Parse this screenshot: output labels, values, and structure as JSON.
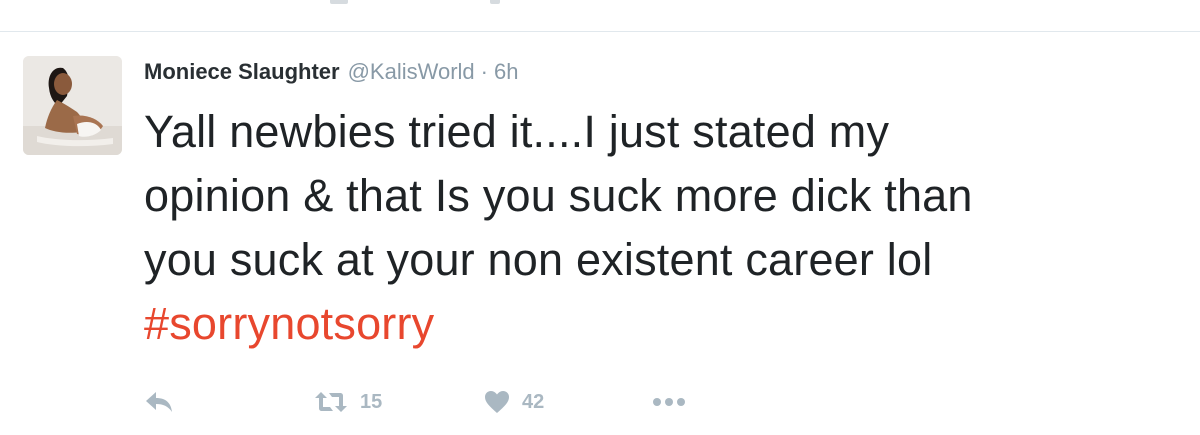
{
  "tweet": {
    "author": {
      "fullname": "Moniece Slaughter",
      "username": "@KalisWorld",
      "separator": "·",
      "timestamp": "6h"
    },
    "text_lines": [
      "Yall newbies tried it....I just stated my",
      "opinion & that Is you suck more dick than",
      "you suck at your non existent career lol"
    ],
    "hashtag": "#sorrynotsorry",
    "actions": {
      "reply_icon": "reply-icon",
      "retweet_icon": "retweet-icon",
      "retweet_count": "15",
      "like_icon": "heart-icon",
      "like_count": "42",
      "more_icon": "more-icon"
    }
  },
  "colors": {
    "hashtag": "#e8472e",
    "muted": "#8899a6",
    "action": "#aab8c2",
    "divider": "#e1e8ed"
  }
}
